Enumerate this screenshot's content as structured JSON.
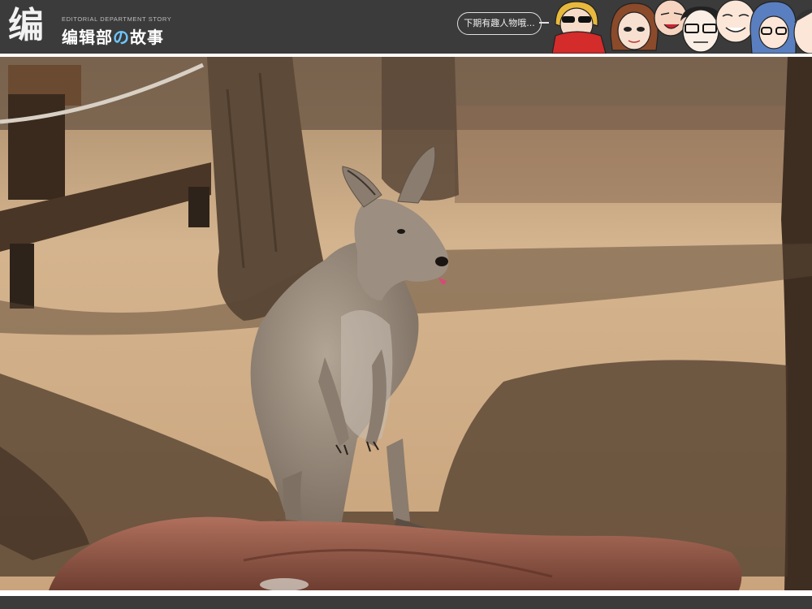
{
  "header": {
    "logo_glyph": "编",
    "brand_en": "EDITORIAL DEPARTMENT STORY",
    "brand_cn_part1": "编辑部",
    "brand_cn_accent": "の",
    "brand_cn_part2": "故事",
    "speech_bubble": "下期有趣人物哦...",
    "colors": {
      "bar": "#3b3b3b",
      "accent": "#6ec6ff"
    }
  },
  "photo": {
    "subject": "kangaroo",
    "colors": {
      "sand": "#c9a77e",
      "shadow": "#4a3a2c",
      "fur": "#8f8173",
      "rock": "#9a5f4e"
    }
  }
}
